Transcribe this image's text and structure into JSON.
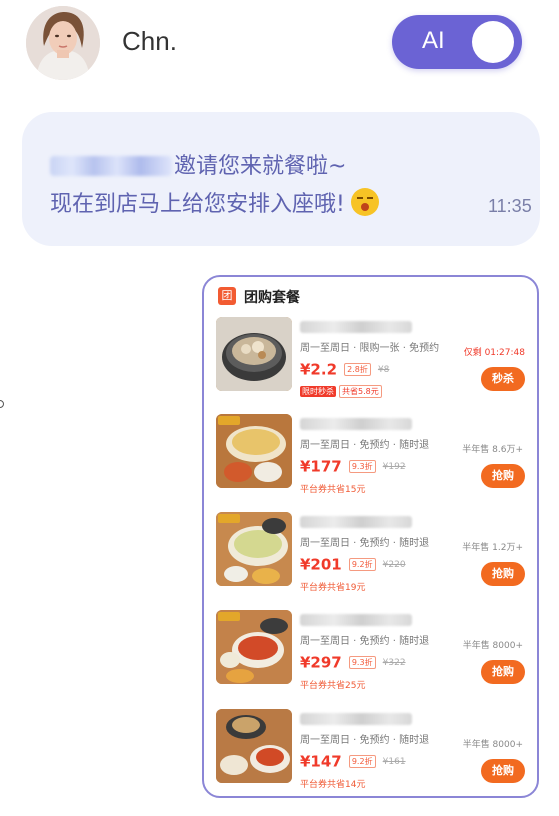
{
  "header": {
    "username": "Chn.",
    "ai_toggle_label": "AI"
  },
  "message": {
    "line1_suffix": "邀请您来就餐啦~",
    "line2": "现在到店马上给您安排入座哦!",
    "time": "11:35"
  },
  "card": {
    "logo_char": "团",
    "title": "团购套餐",
    "deals": [
      {
        "meta": "周一至周日 · 限购一张 · 免预约",
        "price": "¥2.2",
        "discount": "2.8折",
        "original": "¥8",
        "tag_flash": "限时秒杀",
        "tag_coupon": "共省5.8元",
        "countdown": "仅剩 01:27:48",
        "button": "秒杀"
      },
      {
        "meta": "周一至周日 · 免预约 · 随时退",
        "price": "¥177",
        "discount": "9.3折",
        "original": "¥192",
        "coupon": "平台券共省15元",
        "sales": "半年售 8.6万+",
        "button": "抢购"
      },
      {
        "meta": "周一至周日 · 免预约 · 随时退",
        "price": "¥201",
        "discount": "9.2折",
        "original": "¥220",
        "coupon": "平台券共省19元",
        "sales": "半年售 1.2万+",
        "button": "抢购"
      },
      {
        "meta": "周一至周日 · 免预约 · 随时退",
        "price": "¥297",
        "discount": "9.3折",
        "original": "¥322",
        "coupon": "平台券共省25元",
        "sales": "半年售 8000+",
        "button": "抢购"
      },
      {
        "meta": "周一至周日 · 免预约 · 随时退",
        "price": "¥147",
        "discount": "9.2折",
        "original": "¥161",
        "coupon": "平台券共省14元",
        "sales": "半年售 8000+",
        "button": "抢购"
      }
    ]
  }
}
